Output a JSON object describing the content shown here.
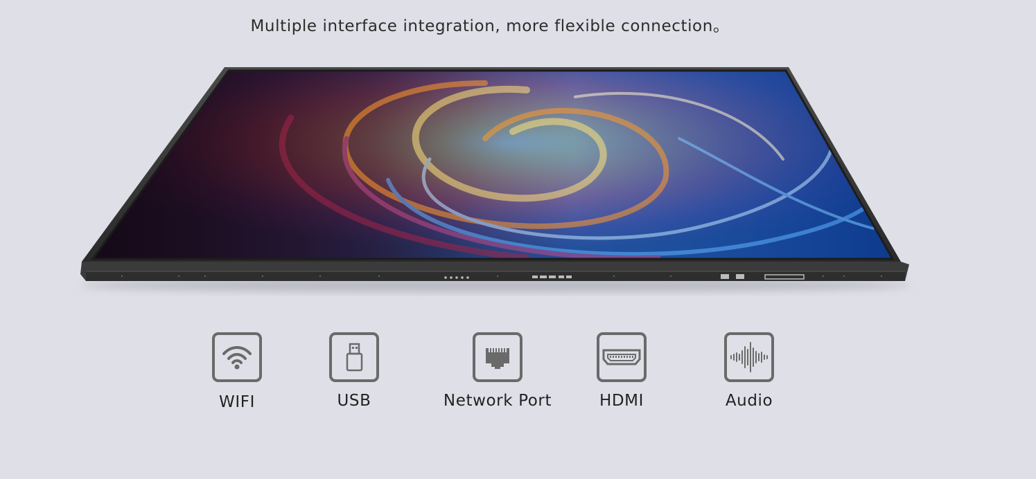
{
  "headline": "Multiple interface integration, more flexible connection。",
  "product_image": {
    "icon": "interactive-display-panel"
  },
  "features": [
    {
      "label": "WIFI",
      "icon": "wifi-icon"
    },
    {
      "label": "USB",
      "icon": "usb-icon"
    },
    {
      "label": "Network Port",
      "icon": "ethernet-port-icon"
    },
    {
      "label": "HDMI",
      "icon": "hdmi-icon"
    },
    {
      "label": "Audio",
      "icon": "audio-waveform-icon"
    }
  ],
  "colors": {
    "background": "#dfe0e7",
    "icon_stroke": "#6a6a6a",
    "text": "#222222"
  }
}
